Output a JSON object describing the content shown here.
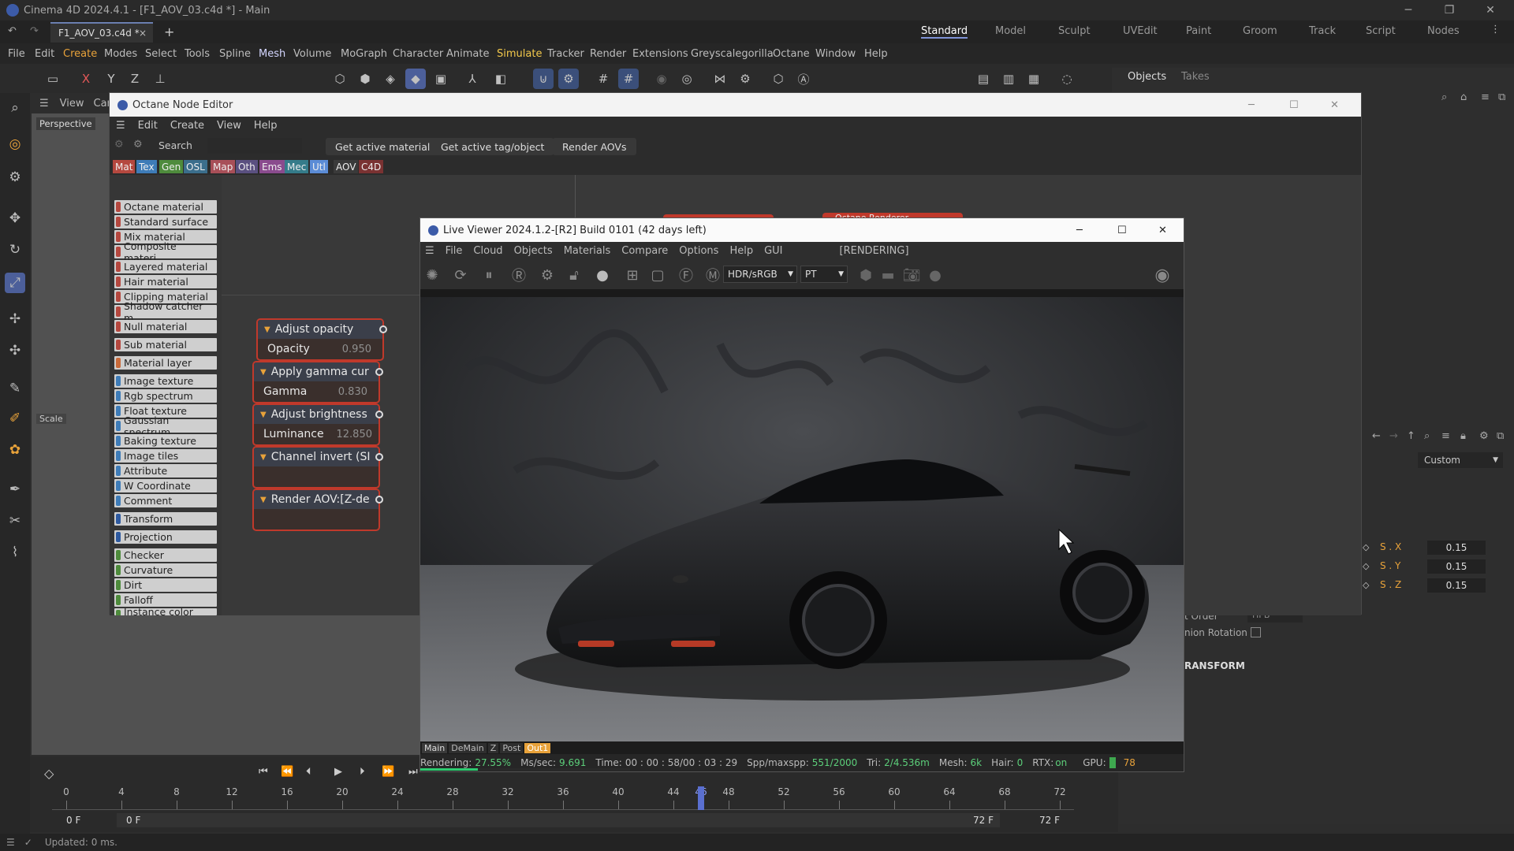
{
  "app": {
    "window_title": "Cinema 4D 2024.4.1 - [F1_AOV_03.c4d *] - Main",
    "file_tab": "F1_AOV_03.c4d *",
    "layouts": [
      "Standard",
      "Model",
      "Sculpt",
      "UVEdit",
      "Paint",
      "Groom",
      "Track",
      "Script",
      "Nodes"
    ],
    "menu": [
      "File",
      "Edit",
      "Create",
      "Modes",
      "Select",
      "Tools",
      "Spline",
      "Mesh",
      "Volume",
      "MoGraph",
      "Character",
      "Animate",
      "Simulate",
      "Tracker",
      "Render",
      "Extensions",
      "Greyscalegorilla",
      "Octane",
      "Window",
      "Help"
    ],
    "axis_x": "X",
    "axis_y": "Y",
    "axis_z": "Z",
    "colors": {
      "accent_create": "#e8a23a",
      "accent_simulate": "#f2c84b",
      "accent_mesh": "#d4d6ff",
      "node_border": "#c0392b"
    }
  },
  "viewport": {
    "view_label": "View",
    "cam_label": "Car",
    "perspective": "Perspective",
    "scale_label": "Scale"
  },
  "right_panel": {
    "tab_objects": "Objects",
    "tab_takes": "Takes",
    "custom": "Custom",
    "sx_label": "S . X",
    "sx": "0.15",
    "sy_label": "S . Y",
    "sy": "0.15",
    "sz_label": "S . Z",
    "sz": "0.15",
    "order_label": "t Order",
    "order_value": "HPB",
    "quat_label": "nion Rotation",
    "transform_label": "RANSFORM"
  },
  "node_editor": {
    "title": "Octane Node Editor",
    "menu": [
      "Edit",
      "Create",
      "View",
      "Help"
    ],
    "search_label": "Search",
    "buttons": [
      "Get active material",
      "Get active tag/object",
      "Render AOVs"
    ],
    "categories": [
      {
        "label": "Mat",
        "color": "#b5483f"
      },
      {
        "label": "Tex",
        "color": "#3e7cb8"
      },
      {
        "label": "Gen",
        "color": "#4e8b3c"
      },
      {
        "label": "OSL",
        "color": "#3b6e8c"
      },
      {
        "label": "Map",
        "color": "#a84f58"
      },
      {
        "label": "Oth",
        "color": "#5a5080"
      },
      {
        "label": "Ems",
        "color": "#8a4b8e"
      },
      {
        "label": "Mec",
        "color": "#357c8a"
      },
      {
        "label": "Utl",
        "color": "#5b8cd6"
      },
      {
        "label": "AOV",
        "color": "#3a3a3a"
      },
      {
        "label": "C4D",
        "color": "#7a3232"
      }
    ],
    "list": [
      {
        "label": "Octane material",
        "color": "#b5483f"
      },
      {
        "label": "Standard surface",
        "color": "#b5483f"
      },
      {
        "label": "Mix material",
        "color": "#b5483f"
      },
      {
        "label": "Composite materi...",
        "color": "#b5483f"
      },
      {
        "label": "Layered material",
        "color": "#b5483f"
      },
      {
        "label": "Hair material",
        "color": "#b5483f"
      },
      {
        "label": "Clipping material",
        "color": "#b5483f"
      },
      {
        "label": "Shadow catcher m...",
        "color": "#b5483f"
      },
      {
        "label": "Null material",
        "color": "#b5483f"
      },
      {
        "label": "Sub material",
        "color": "#b5483f"
      },
      {
        "label": "Material layer",
        "color": "#c86a3a"
      },
      {
        "label": "Image texture",
        "color": "#3e7cb8"
      },
      {
        "label": "Rgb spectrum",
        "color": "#3e7cb8"
      },
      {
        "label": "Float texture",
        "color": "#3e7cb8"
      },
      {
        "label": "Gaussian spectrum",
        "color": "#3e7cb8"
      },
      {
        "label": "Baking texture",
        "color": "#3e7cb8"
      },
      {
        "label": "Image tiles",
        "color": "#3e7cb8"
      },
      {
        "label": "Attribute",
        "color": "#3e7cb8"
      },
      {
        "label": "W Coordinate",
        "color": "#3e7cb8"
      },
      {
        "label": "Comment",
        "color": "#3e7cb8"
      },
      {
        "label": "Transform",
        "color": "#2e5aa0"
      },
      {
        "label": "Projection",
        "color": "#2e5aa0"
      },
      {
        "label": "Checker",
        "color": "#4e8b3c"
      },
      {
        "label": "Curvature",
        "color": "#4e8b3c"
      },
      {
        "label": "Dirt",
        "color": "#4e8b3c"
      },
      {
        "label": "Falloff",
        "color": "#4e8b3c"
      },
      {
        "label": "Instance color",
        "color": "#4e8b3c"
      }
    ],
    "nodes": [
      {
        "title": "Adjust opacity",
        "param": "Opacity",
        "value": "0.950"
      },
      {
        "title": "Apply gamma cur",
        "param": "Gamma",
        "value": "0.830"
      },
      {
        "title": "Adjust brightness",
        "param": "Luminance",
        "value": "12.850"
      },
      {
        "title": "Channel invert (SI",
        "param": "",
        "value": ""
      },
      {
        "title": "Render AOV:[Z-de",
        "param": "",
        "value": ""
      }
    ],
    "bg_node_label": "Octane Renderer"
  },
  "live_viewer": {
    "title": "Live Viewer 2024.1.2-[R2] Build 0101 (42 days left)",
    "menu": [
      "File",
      "Cloud",
      "Objects",
      "Materials",
      "Compare",
      "Options",
      "Help",
      "GUI"
    ],
    "state": "[RENDERING]",
    "colorspace": "HDR/sRGB",
    "kernel": "PT",
    "aov_tabs": [
      "Main",
      "DeMain",
      "Z",
      "Post",
      "Out1"
    ],
    "status": {
      "rendering_label": "Rendering:",
      "rendering": "27.55%",
      "ms_label": "Ms/sec:",
      "ms": "9.691",
      "time_label": "Time:",
      "time": "00 : 00 : 58/00 : 03 : 29",
      "spp_label": "Spp/maxspp:",
      "spp": "551/2000",
      "tri_label": "Tri:",
      "tri": "2/4.536m",
      "mesh_label": "Mesh:",
      "mesh": "6k",
      "hair_label": "Hair:",
      "hair": "0",
      "rtx_label": "RTX:",
      "rtx": "on",
      "gpu_label": "GPU:",
      "gpu": "78"
    },
    "progress": 0.2755
  },
  "timeline": {
    "ticks": [
      "0",
      "4",
      "8",
      "12",
      "16",
      "20",
      "24",
      "28",
      "32",
      "36",
      "40",
      "44",
      "46",
      "48",
      "52",
      "56",
      "60",
      "64",
      "68",
      "72"
    ],
    "current_frame": 46,
    "start_a": "0 F",
    "start_b": "0 F",
    "end_a": "72 F",
    "end_b": "72 F"
  },
  "status_bar": {
    "text": "Updated: 0 ms."
  }
}
